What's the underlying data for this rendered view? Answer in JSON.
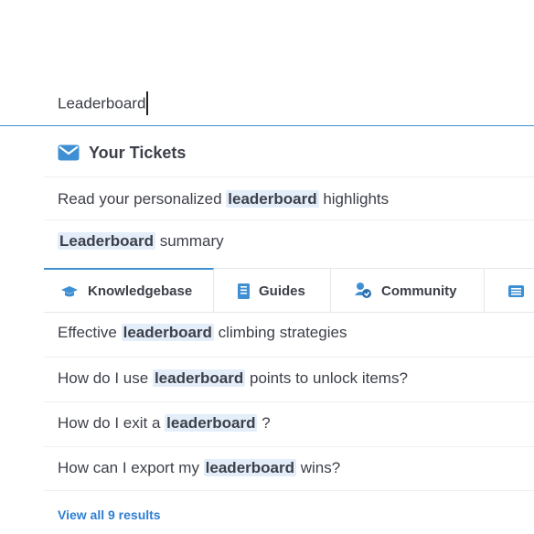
{
  "search": {
    "value": "Leaderboard"
  },
  "tickets": {
    "title": "Your Tickets",
    "items": [
      {
        "pre": "Read your personalized ",
        "hl": "leaderboard",
        "post": " highlights"
      },
      {
        "pre": "",
        "hl": "Leaderboard",
        "post": " summary"
      }
    ]
  },
  "tabs": [
    {
      "label": "Knowledgebase",
      "icon": "graduation-cap-icon",
      "active": true
    },
    {
      "label": "Guides",
      "icon": "book-icon",
      "active": false
    },
    {
      "label": "Community",
      "icon": "community-icon",
      "active": false
    },
    {
      "label": "",
      "icon": "list-icon",
      "active": false
    }
  ],
  "results": [
    {
      "pre": "Effective ",
      "hl": "leaderboard",
      "post": " climbing strategies"
    },
    {
      "pre": "How do I use ",
      "hl": "leaderboard",
      "post": " points to unlock items?"
    },
    {
      "pre": "How do I exit a ",
      "hl": "leaderboard",
      "post": " ?"
    },
    {
      "pre": "How can I export my ",
      "hl": "leaderboard",
      "post": " wins?"
    }
  ],
  "view_all": "View all 9 results",
  "colors": {
    "accent": "#3f8fd4",
    "highlight_bg": "#e3eefa",
    "link": "#2f7ed2"
  }
}
